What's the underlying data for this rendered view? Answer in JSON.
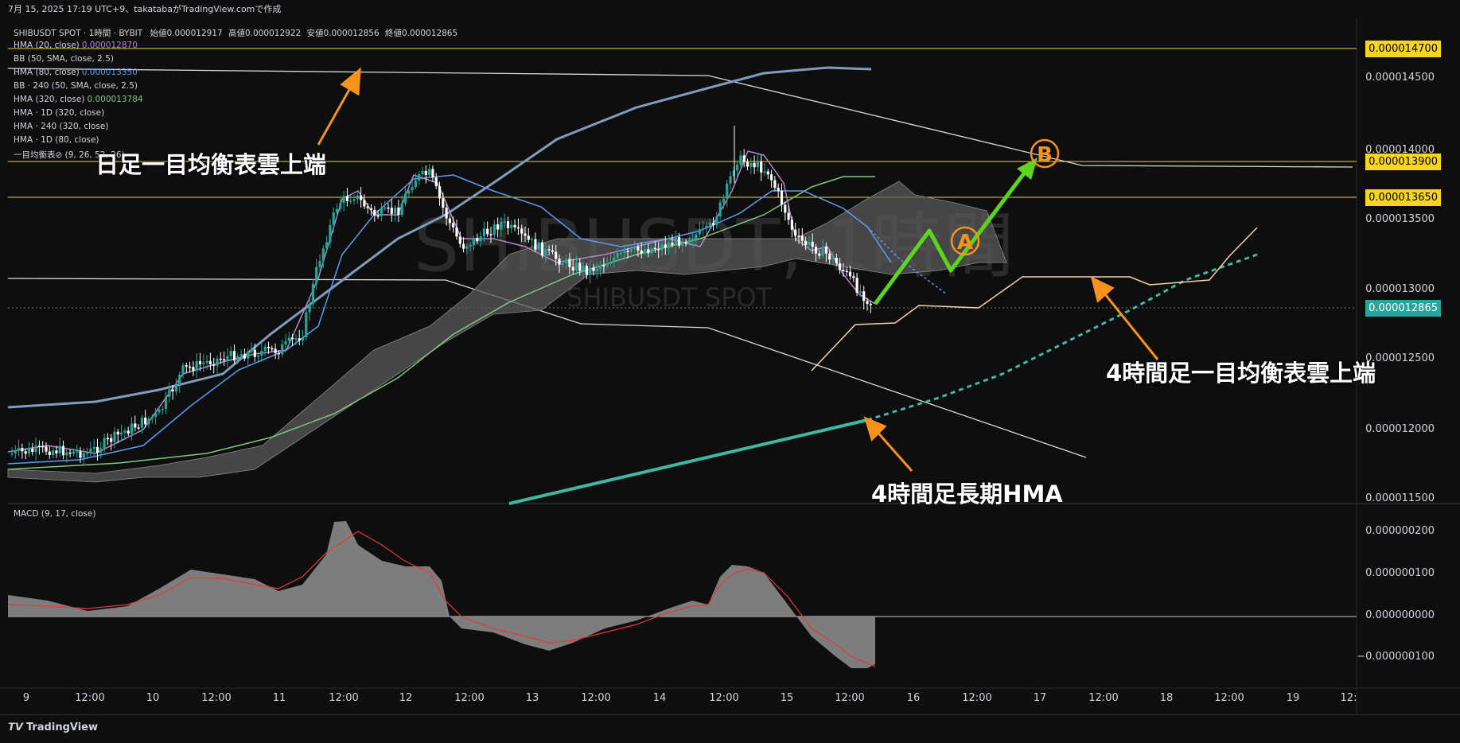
{
  "header": {
    "text": "7月 15, 2025 17:19 UTC+9、takatabaがTradingView.comで作成"
  },
  "symbol_line": {
    "symbol": "SHIBUSDT SPOT · 1時間 · BYBIT",
    "open_label": "始値",
    "open": "0.000012917",
    "high_label": "高値",
    "high": "0.000012922",
    "low_label": "安値",
    "low": "0.000012856",
    "close_label": "終値",
    "close": "0.000012865"
  },
  "indicators": [
    {
      "label": "HMA (20, close)",
      "value": "0.000012870",
      "color": "#b388c7"
    },
    {
      "label": "BB (50, SMA, close, 2.5)",
      "value": "",
      "color": "#d1d4dc"
    },
    {
      "label": "HMA (80, close)",
      "value": "0.000013350",
      "color": "#5b9cf6"
    },
    {
      "label": "BB · 240 (50, SMA, close, 2.5)",
      "value": "",
      "color": "#d1d4dc"
    },
    {
      "label": "HMA (320, close)",
      "value": "0.000013784",
      "color": "#81c784"
    },
    {
      "label": "HMA · 1D (320, close)",
      "value": "",
      "color": "#d1d4dc"
    },
    {
      "label": "HMA · 240 (320, close)",
      "value": "",
      "color": "#d1d4dc"
    },
    {
      "label": "HMA · 1D (80, close)",
      "value": "",
      "color": "#d1d4dc"
    },
    {
      "label": "一目均衡表⊘ (9, 26, 52, 26)",
      "value": "",
      "color": "#d1d4dc"
    }
  ],
  "watermark": {
    "big": "SHIBUSDT, 1時間",
    "small": "SHIBUSDT SPOT"
  },
  "annotations": {
    "daily_cloud": "日足一目均衡表雲上端",
    "h4_cloud": "4時間足一目均衡表雲上端",
    "h4_hma": "4時間足長期HMA",
    "point_a": "A",
    "point_b": "B"
  },
  "price_axis": {
    "labels": [
      "0.000014500",
      "0.000014000",
      "0.000013500",
      "0.000013000",
      "0.000012500",
      "0.000012000",
      "0.000011500"
    ],
    "badges": [
      {
        "value": "0.000014700",
        "bg": "#f7d51d",
        "fg": "#000000"
      },
      {
        "value": "0.000013900",
        "bg": "#f7d51d",
        "fg": "#000000"
      },
      {
        "value": "0.000013650",
        "bg": "#f7d51d",
        "fg": "#000000"
      },
      {
        "value": "0.000012865",
        "bg": "#26a69a",
        "fg": "#ffffff"
      }
    ]
  },
  "macd": {
    "title": "MACD (9, 17, close)",
    "labels": [
      "0.000000200",
      "0.000000100",
      "0.000000000",
      "−0.000000100"
    ]
  },
  "time_axis": [
    "9",
    "12:00",
    "10",
    "12:00",
    "11",
    "12:00",
    "12",
    "12:00",
    "13",
    "12:00",
    "14",
    "12:00",
    "15",
    "12:00",
    "16",
    "12:00",
    "17",
    "12:00",
    "18",
    "12:00",
    "19",
    "12:"
  ],
  "footer": {
    "brand": "TradingView"
  },
  "colors": {
    "background": "#0e0e0e",
    "up_candle": "#26a69a",
    "down_candle": "#ffffff",
    "hma20": "#b388c7",
    "hma80": "#5b9cf6",
    "hma320": "#81c784",
    "hma_1d_80": "#7f9cbf",
    "h4_hma": "#3fb8a3",
    "cloud": "#555555",
    "green_arrow": "#5cd61c",
    "orange": "#f7931a",
    "cloud_upper": "#f6d3a6"
  },
  "chart_data": {
    "type": "candlestick",
    "title": "SHIBUSDT SPOT · 1時間 · BYBIT",
    "ylim": [
      1.15e-05,
      1.475e-05
    ],
    "y_ticks": [
      1.45e-05,
      1.4e-05,
      1.35e-05,
      1.3e-05,
      1.25e-05,
      1.2e-05,
      1.15e-05
    ],
    "x_ticks": [
      "9",
      "12:00",
      "10",
      "12:00",
      "11",
      "12:00",
      "12",
      "12:00",
      "13",
      "12:00",
      "14",
      "12:00",
      "15",
      "12:00",
      "16",
      "12:00",
      "17",
      "12:00",
      "18",
      "12:00",
      "19",
      "12:"
    ],
    "horizontal_levels": [
      1.47e-05,
      1.39e-05,
      1.365e-05,
      1.2865e-05
    ],
    "last_price": 1.2865e-05,
    "projection": {
      "name": "predicted path",
      "points": [
        {
          "x": "15 12:00",
          "y": 1.29e-05
        },
        {
          "x": "A",
          "y": 1.35e-05
        },
        {
          "x": "",
          "y": 1.32e-05
        },
        {
          "x": "B",
          "y": 1.39e-05
        }
      ]
    },
    "macd": {
      "ylim": [
        -1.2e-07,
        2.4e-07
      ],
      "ticks": [
        2e-07,
        1e-07,
        0,
        -1e-07
      ]
    }
  }
}
